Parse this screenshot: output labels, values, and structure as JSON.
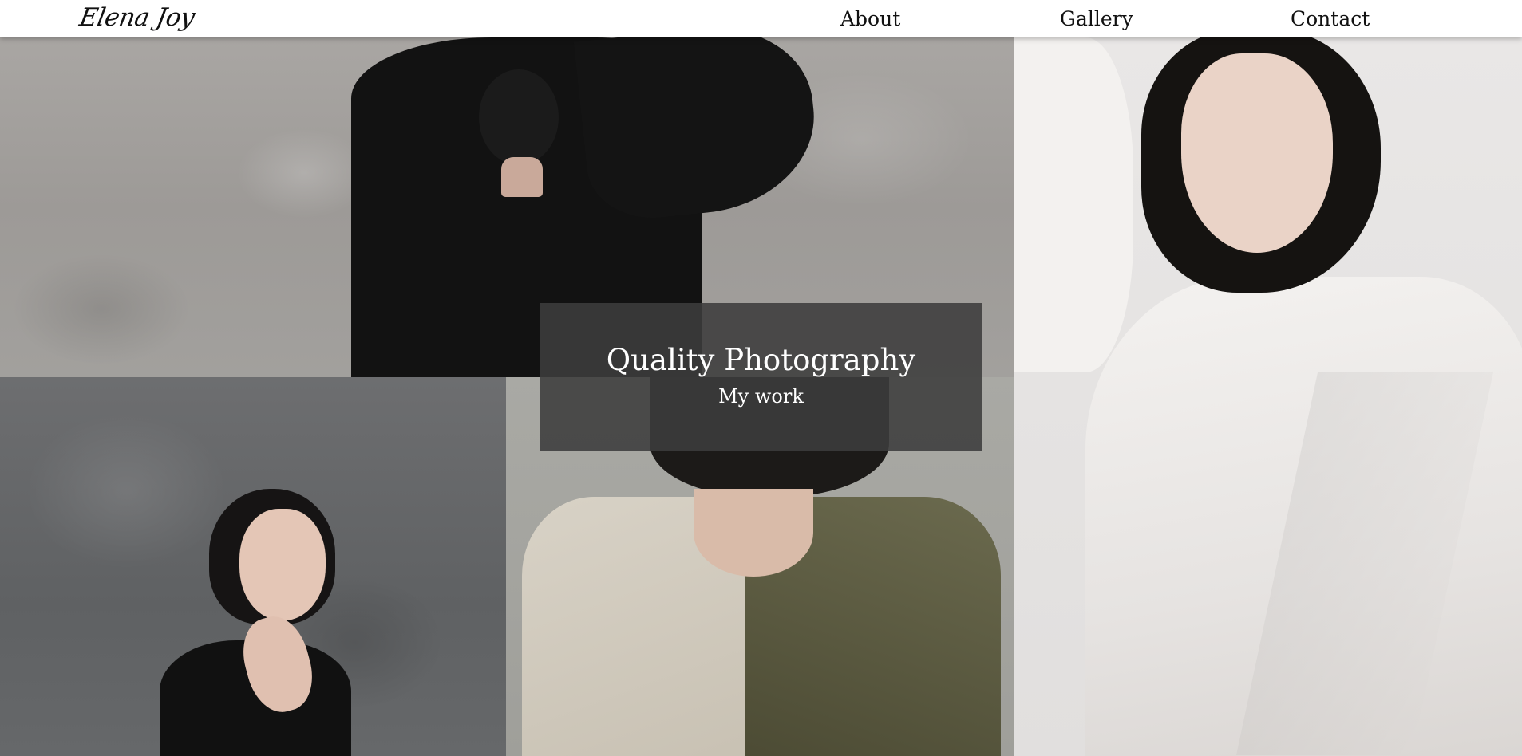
{
  "header": {
    "logo_text": "Elena Joy",
    "nav": {
      "about": "About",
      "gallery": "Gallery",
      "contact": "Contact"
    }
  },
  "hero": {
    "title": "Quality Photography",
    "subtitle": "My work"
  },
  "gallery": {
    "photos": [
      {
        "subject": "person in black with arms raised against grey wall"
      },
      {
        "subject": "woman with hand on neck against dark grey wall"
      },
      {
        "subject": "person in beige and olive coat"
      },
      {
        "subject": "woman in white draped outfit"
      }
    ]
  },
  "colors": {
    "header_bg": "#ffffff",
    "caption_bg": "#3c3c3c",
    "text_dark": "#111111",
    "text_light": "#ffffff"
  }
}
